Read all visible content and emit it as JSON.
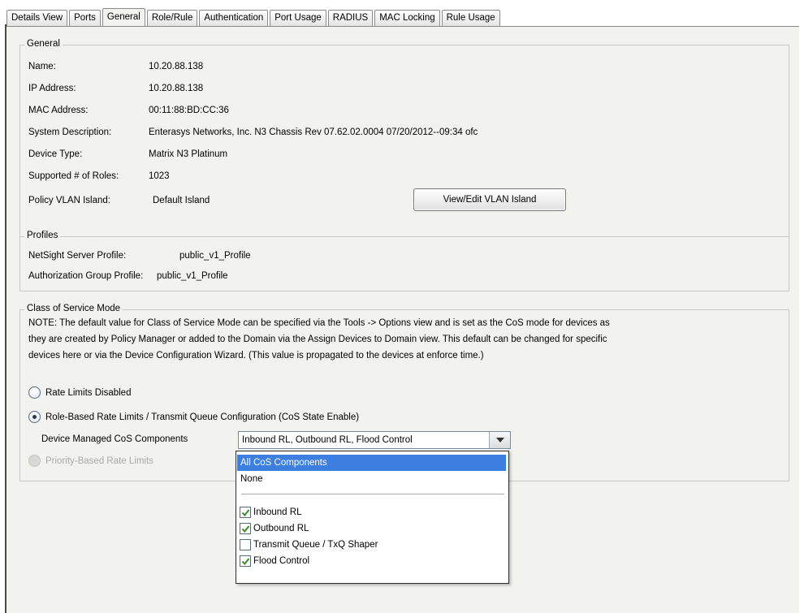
{
  "tabs": [
    "Details View",
    "Ports",
    "General",
    "Role/Rule",
    "Authentication",
    "Port Usage",
    "RADIUS",
    "MAC Locking",
    "Rule Usage"
  ],
  "active_tab": "General",
  "general": {
    "title": "General",
    "fields": [
      {
        "label": "Name:",
        "value": "10.20.88.138"
      },
      {
        "label": "IP Address:",
        "value": "10.20.88.138"
      },
      {
        "label": "MAC Address:",
        "value": "00:11:88:BD:CC:36"
      },
      {
        "label": "System Description:",
        "value": "Enterasys Networks, Inc. N3 Chassis Rev 07.62.02.0004 07/20/2012--09:34 ofc"
      },
      {
        "label": "Device Type:",
        "value": "Matrix N3 Platinum"
      },
      {
        "label": "Supported # of Roles:",
        "value": "1023"
      }
    ],
    "vlan_island_label": "Policy VLAN Island:",
    "vlan_island_value": "Default Island",
    "vlan_button": "View/Edit VLAN Island"
  },
  "profiles": {
    "title": "Profiles",
    "netsight_label": "NetSight Server Profile:",
    "netsight_value": "public_v1_Profile",
    "auth_label": "Authorization Group Profile:",
    "auth_value": "public_v1_Profile"
  },
  "cos": {
    "title": "Class of Service Mode",
    "note_lines": [
      "NOTE: The default value for Class of Service Mode can be specified via the Tools -> Options view and is set as the CoS mode for devices as",
      "they are created by Policy Manager or added to the Domain via the Assign Devices to Domain view. This default can be changed for specific",
      "devices here or via the Device Configuration Wizard. (This value is propagated to the devices at enforce time.)"
    ],
    "radio_disabled_label": "Rate Limits Disabled",
    "radio_role_label": "Role-Based Rate Limits / Transmit Queue Configuration (CoS State Enable)",
    "components_label": "Device Managed CoS Components",
    "components_value": "Inbound RL, Outbound RL, Flood Control",
    "radio_priority_label": "Priority-Based Rate Limits",
    "dropdown_options": [
      "All CoS Components",
      "None"
    ],
    "dropdown_checks": [
      {
        "label": "Inbound RL",
        "checked": true
      },
      {
        "label": "Outbound RL",
        "checked": true
      },
      {
        "label": "Transmit Queue / TxQ Shaper",
        "checked": false
      },
      {
        "label": "Flood Control",
        "checked": true
      }
    ]
  }
}
